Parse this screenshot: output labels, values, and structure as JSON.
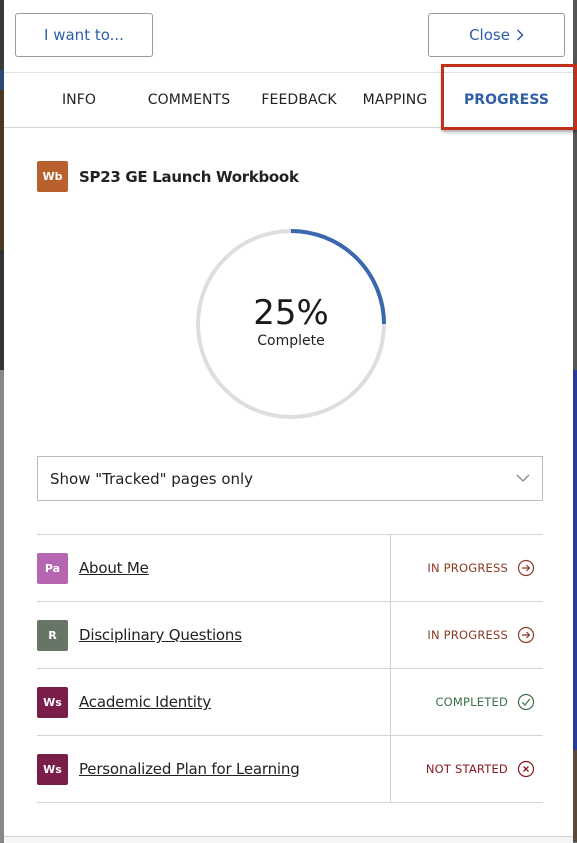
{
  "header": {
    "i_want_to_label": "I want to...",
    "close_label": "Close"
  },
  "tabs": [
    {
      "label": "INFO",
      "active": false
    },
    {
      "label": "COMMENTS",
      "active": false
    },
    {
      "label": "FEEDBACK",
      "active": false
    },
    {
      "label": "MAPPING",
      "active": false
    },
    {
      "label": "PROGRESS",
      "active": true
    }
  ],
  "workbook": {
    "badge": "Wb",
    "badge_color": "#b8612f",
    "title": "SP23 GE Launch Workbook"
  },
  "progress": {
    "percent": 25,
    "percent_label": "25%",
    "label": "Complete",
    "track_color": "#dedede",
    "fill_color": "#3a67ae"
  },
  "filter": {
    "selected": "Show \"Tracked\" pages only"
  },
  "pages": [
    {
      "badge": "Pa",
      "badge_color": "#b466b0",
      "name": "About Me",
      "status": "IN PROGRESS",
      "status_color": "#8a3a22",
      "status_icon": "arrow-circle-right"
    },
    {
      "badge": "R",
      "badge_color": "#667566",
      "name": "Disciplinary Questions",
      "status": "IN PROGRESS",
      "status_color": "#8a3a22",
      "status_icon": "arrow-circle-right"
    },
    {
      "badge": "Ws",
      "badge_color": "#7a1d48",
      "name": "Academic Identity",
      "status": "COMPLETED",
      "status_color": "#3d7048",
      "status_icon": "check-circle"
    },
    {
      "badge": "Ws",
      "badge_color": "#7a1d48",
      "name": "Personalized Plan for Learning",
      "status": "NOT STARTED",
      "status_color": "#8a1a22",
      "status_icon": "x-circle"
    }
  ]
}
